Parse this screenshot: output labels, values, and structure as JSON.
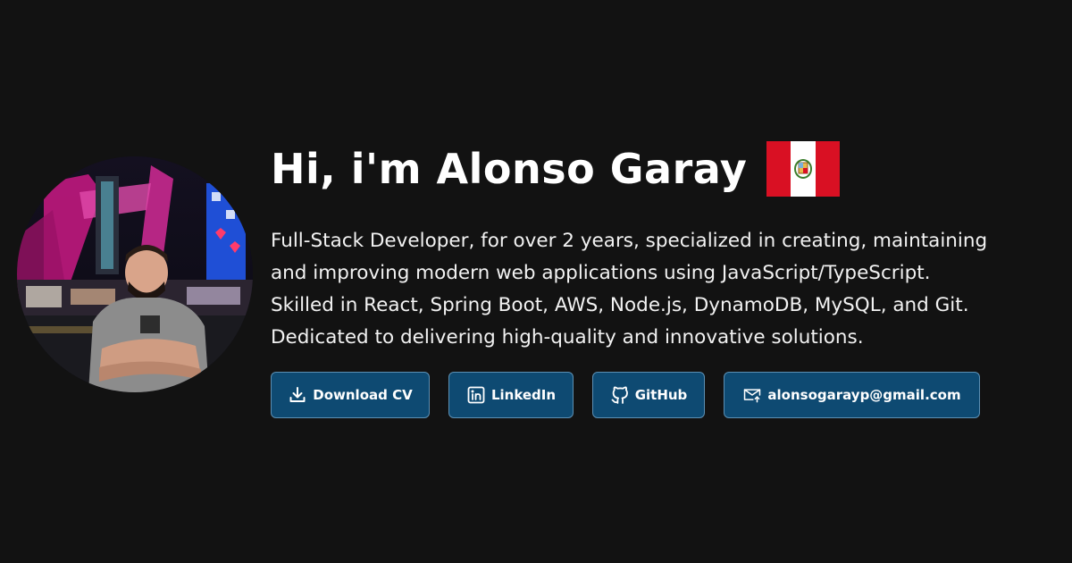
{
  "profile": {
    "greeting": "Hi, i'm Alonso Garay",
    "flag_icon": "peru-flag-icon",
    "photo_icon": "profile-photo",
    "bio_lines": [
      "Full-Stack Developer, for over 2 years, specialized in creating, maintaining",
      "and improving modern web applications using JavaScript/TypeScript.",
      "Skilled in React, Spring Boot, AWS, Node.js, DynamoDB, MySQL, and Git.",
      "Dedicated to delivering high-quality and innovative solutions."
    ]
  },
  "buttons": {
    "download_cv": {
      "label": "Download CV",
      "icon": "download-icon"
    },
    "linkedin": {
      "label": "LinkedIn",
      "icon": "linkedin-icon"
    },
    "github": {
      "label": "GitHub",
      "icon": "github-icon"
    },
    "email": {
      "label": "alonsogarayp@gmail.com",
      "icon": "mail-icon"
    }
  },
  "colors": {
    "background": "#121212",
    "button_bg": "#0e4a72",
    "button_border": "#5b8fb3",
    "flag_red": "#d91023",
    "text": "#ffffff"
  }
}
